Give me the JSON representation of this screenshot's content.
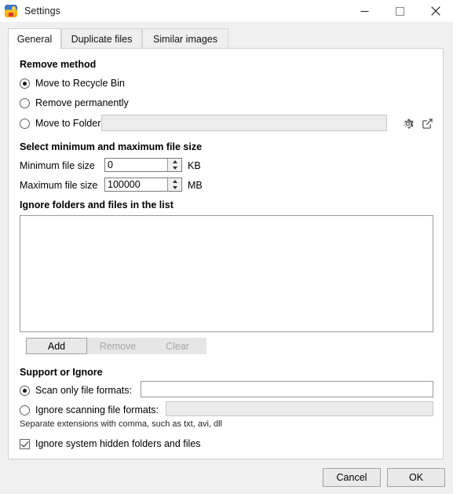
{
  "window": {
    "title": "Settings",
    "icon": "app-icon",
    "controls": [
      {
        "name": "minimize",
        "glyph": "—"
      },
      {
        "name": "maximize",
        "glyph": "□"
      },
      {
        "name": "close",
        "glyph": "✕"
      }
    ]
  },
  "tabs": [
    {
      "label": "General",
      "active": true
    },
    {
      "label": "Duplicate files",
      "active": false
    },
    {
      "label": "Similar images",
      "active": false
    }
  ],
  "general": {
    "remove_method": {
      "title": "Remove method",
      "options": [
        {
          "label": "Move to Recycle Bin",
          "selected": true
        },
        {
          "label": "Remove permanently",
          "selected": false
        },
        {
          "label": "Move to Folder",
          "selected": false
        }
      ],
      "folder_path_value": "",
      "folder_path_placeholder": "",
      "settings_icon": "gear-icon",
      "open_icon": "open-external-icon"
    },
    "file_size": {
      "title": "Select minimum and maximum file size",
      "minimum": {
        "label": "Minimum file size",
        "value": "0",
        "unit": "KB"
      },
      "maximum": {
        "label": "Maximum file size",
        "value": "100000",
        "unit": "MB"
      }
    },
    "ignore_list": {
      "title": "Ignore folders and files in the list",
      "items": [],
      "buttons": [
        {
          "label": "Add",
          "enabled": true
        },
        {
          "label": "Remove",
          "enabled": false
        },
        {
          "label": "Clear",
          "enabled": false
        }
      ]
    },
    "support_or_ignore": {
      "title": "Support or Ignore",
      "scan_only": {
        "label": "Scan only file formats:",
        "selected": true,
        "value": "",
        "enabled": true
      },
      "ignore_scanning": {
        "label": "Ignore scanning file formats:",
        "selected": false,
        "value": "",
        "enabled": false
      },
      "hint": "Separate extensions with comma, such as txt, avi, dll",
      "hidden_files": {
        "label": "Ignore system hidden folders and files",
        "checked": true
      }
    }
  },
  "footer": {
    "cancel_label": "Cancel",
    "ok_label": "OK"
  }
}
